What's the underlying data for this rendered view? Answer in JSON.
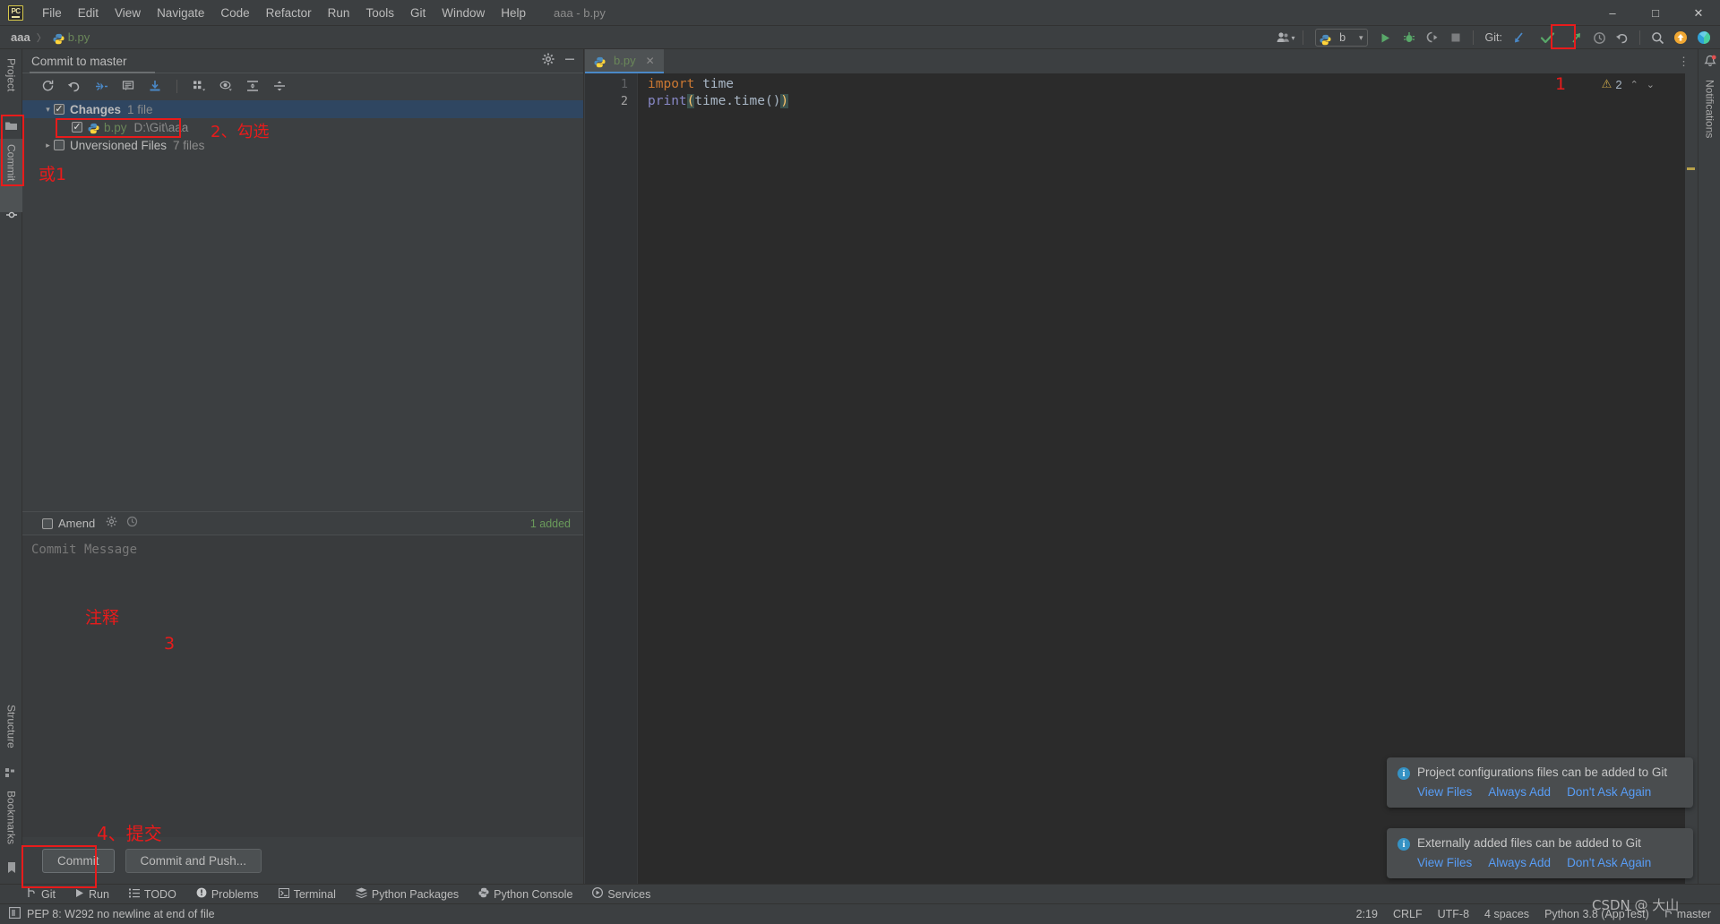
{
  "window": {
    "title": "aaa - b.py",
    "minimize": "–",
    "maximize": "□",
    "close": "✕"
  },
  "menu": {
    "logo": "PC",
    "items": [
      "File",
      "Edit",
      "View",
      "Navigate",
      "Code",
      "Refactor",
      "Run",
      "Tools",
      "Git",
      "Window",
      "Help"
    ]
  },
  "breadcrumb": {
    "project": "aaa",
    "separator": "〉",
    "file": "b.py"
  },
  "toolbar": {
    "run_config_name": "b",
    "git_label": "Git:",
    "icons": {
      "user": "user-icon",
      "run": "run-icon",
      "debug": "debug-icon",
      "coverage": "coverage-icon",
      "stop": "stop-icon",
      "update": "git-update-icon",
      "commit": "git-commit-check-icon",
      "push": "git-push-icon",
      "history": "history-icon",
      "rollback": "rollback-icon",
      "search": "search-icon",
      "updates": "updates-icon",
      "ide": "ide-icon",
      "settings": "settings-icon"
    }
  },
  "left_stripe": {
    "project": "Project",
    "commit": "Commit",
    "structure": "Structure",
    "bookmarks": "Bookmarks"
  },
  "right_stripe": {
    "notifications": "Notifications"
  },
  "commit_panel": {
    "title": "Commit to master",
    "toolbar_icons": [
      "refresh-icon",
      "rollback-icon",
      "diff-icon",
      "message-history-icon",
      "download-icon",
      "group-by-icon",
      "preview-diff-icon",
      "expand-all-icon",
      "collapse-all-icon"
    ],
    "header_icons": [
      "gear-icon",
      "minimize-icon"
    ],
    "tree": {
      "changes": {
        "label": "Changes",
        "count": "1 file",
        "checked": true,
        "expanded": true
      },
      "file": {
        "name": "b.py",
        "path": "D:\\Git\\aaa",
        "checked": true
      },
      "unversioned": {
        "label": "Unversioned Files",
        "count": "7 files",
        "checked": false,
        "expanded": false
      }
    },
    "amend": {
      "label": "Amend",
      "checked": false,
      "added_count": "1 added"
    },
    "message_placeholder": "Commit Message",
    "buttons": {
      "commit": "Commit",
      "commit_and_push": "Commit and Push..."
    }
  },
  "editor": {
    "tab": {
      "name": "b.py",
      "close": "✕"
    },
    "lines": [
      {
        "num": "1",
        "tokens": [
          {
            "t": "import",
            "c": "kw"
          },
          {
            "t": "  time",
            "c": "plain"
          }
        ]
      },
      {
        "num": "2",
        "tokens": [
          {
            "t": "print",
            "c": "fn"
          },
          {
            "t": "(",
            "c": "paren"
          },
          {
            "t": "time.time()",
            "c": "plain"
          },
          {
            "t": ")",
            "c": "paren"
          }
        ]
      }
    ],
    "raw_lines": [
      "import  time",
      "print(time.time())"
    ],
    "warnings": {
      "count": "2",
      "icon": "warning-triangle-icon"
    }
  },
  "notifications": [
    {
      "text": "Project configurations files can be added to Git",
      "actions": [
        "View Files",
        "Always Add",
        "Don't Ask Again"
      ]
    },
    {
      "text": "Externally added files can be added to Git",
      "actions": [
        "View Files",
        "Always Add",
        "Don't Ask Again"
      ]
    }
  ],
  "tool_tabs": [
    {
      "label": "Git",
      "icon": "git-branch-icon"
    },
    {
      "label": "Run",
      "icon": "run-icon"
    },
    {
      "label": "TODO",
      "icon": "todo-list-icon"
    },
    {
      "label": "Problems",
      "icon": "problems-icon"
    },
    {
      "label": "Terminal",
      "icon": "terminal-icon"
    },
    {
      "label": "Python Packages",
      "icon": "packages-icon"
    },
    {
      "label": "Python Console",
      "icon": "python-console-icon"
    },
    {
      "label": "Services",
      "icon": "services-icon"
    }
  ],
  "status_bar": {
    "message": "PEP 8: W292 no newline at end of file",
    "message_icon": "inspection-icon",
    "caret": "2:19",
    "line_sep": "CRLF",
    "encoding": "UTF-8",
    "indent": "4 spaces",
    "interpreter": "Python 3.8 (AppTest)",
    "branch": "master",
    "branch_icon": "git-branch-icon"
  },
  "annotations": {
    "a1": "1",
    "a2": "2、勾选",
    "a_or1": "或1",
    "a3_note": "注释",
    "a3": "3",
    "a4": "4、提交"
  },
  "watermark": "CSDN @ 大山",
  "colors": {
    "accent_blue": "#4a88c7",
    "link_blue": "#589df6",
    "green_file": "#6a8759",
    "annotation_red": "#e81b1b",
    "selection_blue": "#2f4661",
    "bg_panel": "#3c3f41",
    "bg_editor": "#2b2b2b"
  }
}
